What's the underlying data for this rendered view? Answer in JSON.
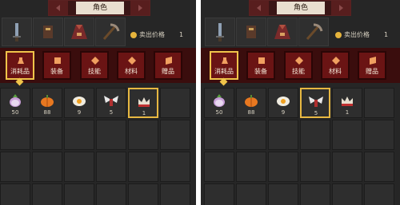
{
  "header": {
    "title": "角色"
  },
  "sell": {
    "label": "卖出价格",
    "value": "1"
  },
  "tabs": [
    {
      "label": "消耗品",
      "icon": "potion-icon"
    },
    {
      "label": "装备",
      "icon": "armor-icon"
    },
    {
      "label": "技能",
      "icon": "diamond-icon"
    },
    {
      "label": "材料",
      "icon": "material-icon"
    },
    {
      "label": "赠品",
      "icon": "scroll-icon"
    }
  ],
  "items": [
    {
      "name": "turnip",
      "count": "50"
    },
    {
      "name": "pumpkin",
      "count": "88"
    },
    {
      "name": "fried-egg",
      "count": "9"
    },
    {
      "name": "wings",
      "count": "5"
    },
    {
      "name": "crown",
      "count": "1"
    }
  ],
  "colors": {
    "panel": "#262626",
    "tab_red": "#6a1414",
    "highlight": "#e7b842"
  }
}
